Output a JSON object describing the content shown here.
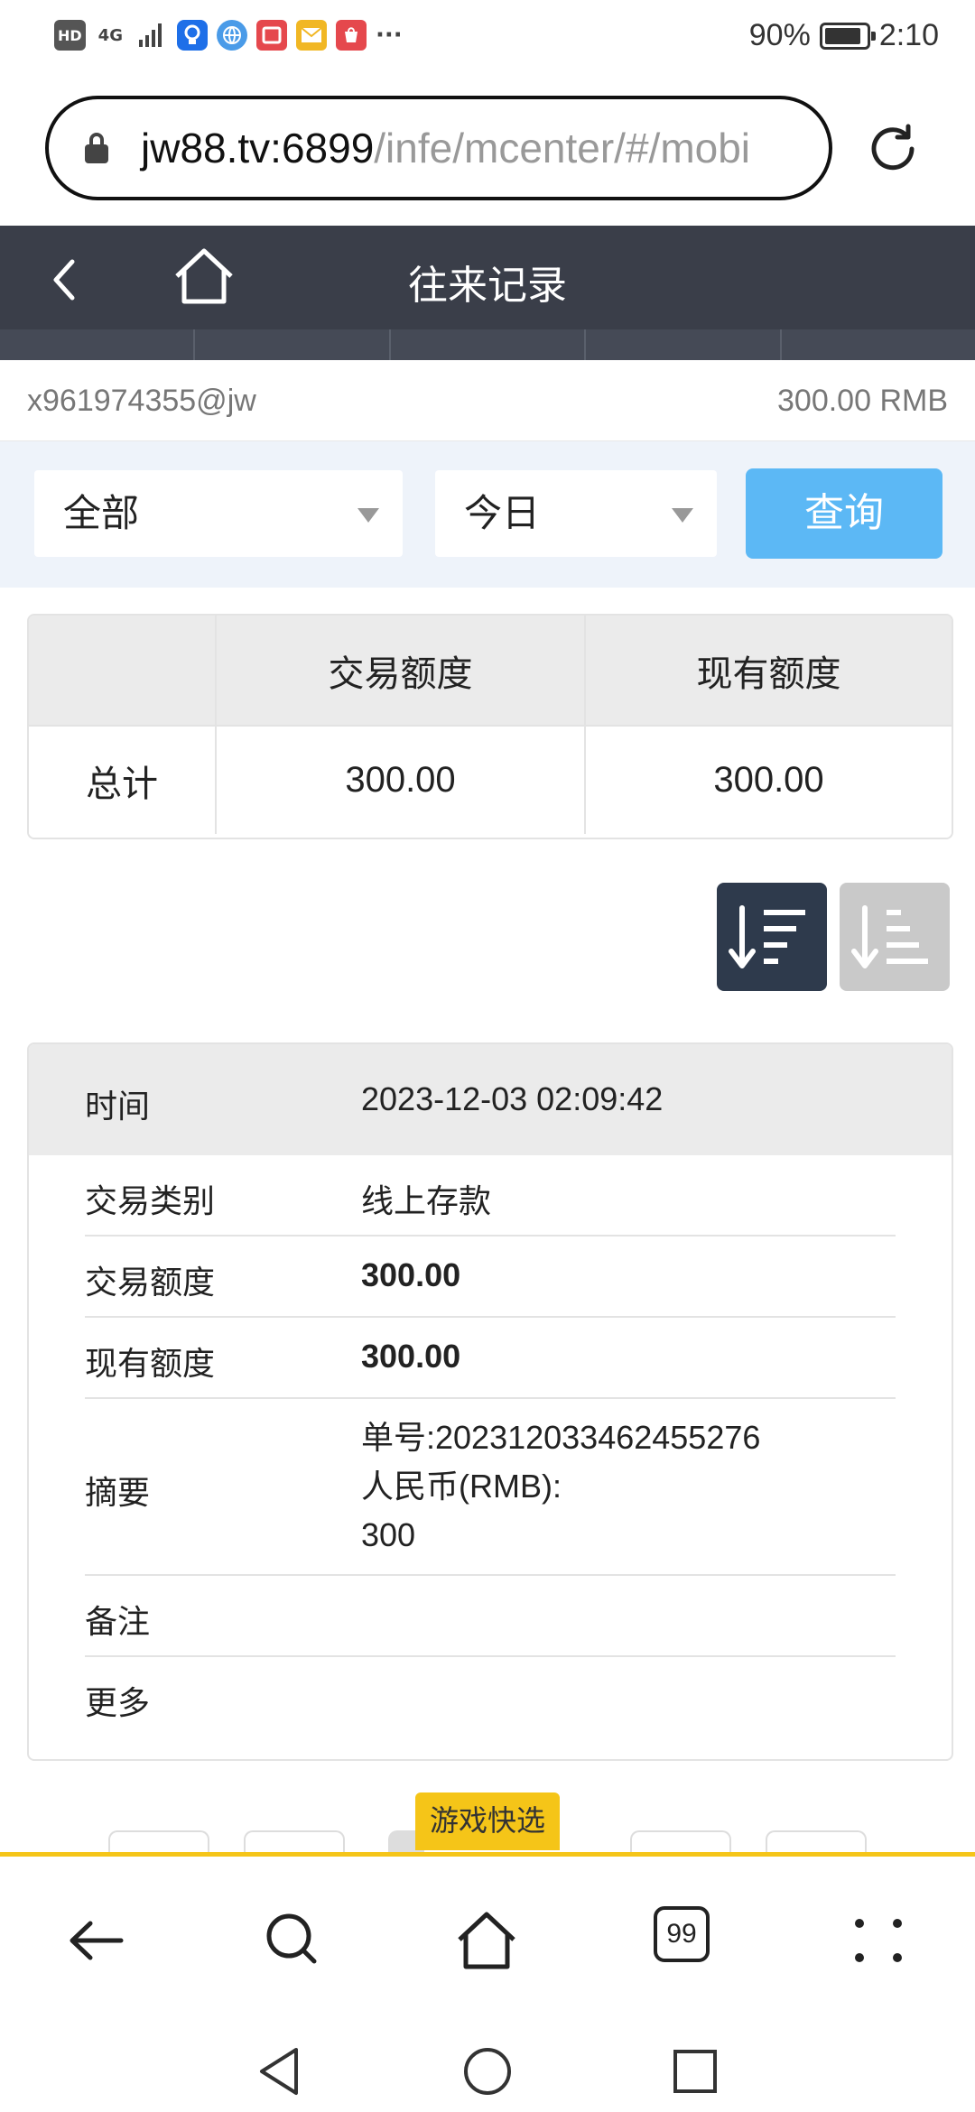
{
  "status_bar": {
    "left_icons": [
      "hd-icon",
      "4g-signal-icon",
      "signal-bars-icon",
      "bulb-app-icon",
      "browser-app-icon",
      "book-app-icon",
      "mail-app-icon",
      "appgallery-icon",
      "more-dots-icon"
    ],
    "hd_label": "HD",
    "network_label": "4G",
    "more": "···",
    "battery": "90%",
    "battery_level": 0.9,
    "time": "2:10"
  },
  "browser": {
    "url_host": "jw88.tv:6899",
    "url_path": "/infe/mcenter/#/mobi"
  },
  "header": {
    "title": "往来记录"
  },
  "account": {
    "username": "x961974355@jw",
    "balance": "300.00 RMB"
  },
  "filter": {
    "category": "全部",
    "date_range": "今日",
    "query_label": "查询"
  },
  "summary": {
    "headers": [
      "",
      "交易额度",
      "现有额度"
    ],
    "row_label": "总计",
    "transaction_amount": "300.00",
    "current_amount": "300.00"
  },
  "record": {
    "time_label": "时间",
    "time_value": "2023-12-03 02:09:42",
    "type_label": "交易类别",
    "type_value": "线上存款",
    "amount_label": "交易额度",
    "amount_value": "300.00",
    "balance_label": "现有额度",
    "balance_value": "300.00",
    "summary_label": "摘要",
    "summary_line1": "单号:202312033462455276",
    "summary_line2": "人民币(RMB):",
    "summary_line3": "300",
    "note_label": "备注",
    "more_label": "更多"
  },
  "floating": {
    "games_label": "游戏快选"
  },
  "bottom_nav": {
    "tabs_count": "99"
  }
}
